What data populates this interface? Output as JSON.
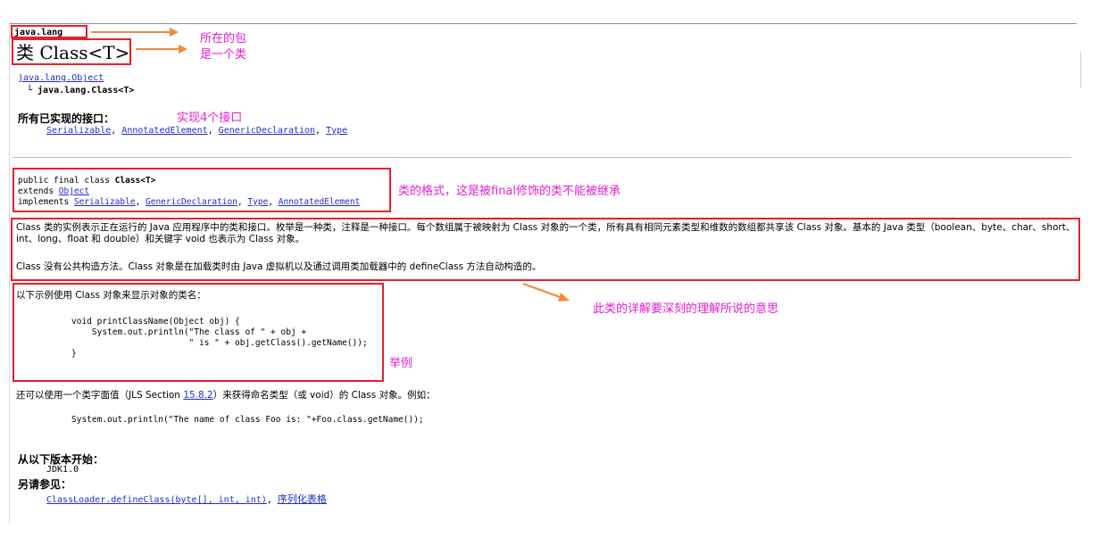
{
  "header": {
    "package": "java.lang",
    "class_title": "类 Class<T>"
  },
  "hierarchy": {
    "parent": "java.lang.Object",
    "child": "└ java.lang.Class<T>"
  },
  "interfaces": {
    "label": "所有已实现的接口：",
    "items": [
      "Serializable",
      "AnnotatedElement",
      "GenericDeclaration",
      "Type"
    ]
  },
  "declaration": {
    "line1_prefix": "public final class ",
    "line1_name": "Class<T>",
    "extends_label": "extends ",
    "extends_link": "Object",
    "implements_label": "implements ",
    "implements_links": [
      "Serializable",
      "GenericDeclaration",
      "Type",
      "AnnotatedElement"
    ]
  },
  "description": {
    "para1": "Class 类的实例表示正在运行的 Java 应用程序中的类和接口。枚举是一种类，注释是一种接口。每个数组属于被映射为 Class 对象的一个类，所有具有相同元素类型和维数的数组都共享该 Class 对象。基本的 Java 类型（boolean、byte、char、short、int、long、float 和 double）和关键字 void 也表示为 Class 对象。",
    "para2": "Class 没有公共构造方法。Class 对象是在加载类时由 Java 虚拟机以及通过调用类加载器中的 defineClass 方法自动构造的。"
  },
  "example": {
    "intro": "以下示例使用 Class 对象来显示对象的类名：",
    "code": "void printClassName(Object obj) {\n    System.out.println(\"The class of \" + obj +\n                       \" is \" + obj.getClass().getName());\n}"
  },
  "literal": {
    "text_before": "还可以使用一个类字面值（JLS Section ",
    "link": "15.8.2",
    "text_after": "）来获得命名类型（或 void）的 Class 对象。例如：",
    "code": "System.out.println(\"The name of class Foo is: \"+Foo.class.getName());"
  },
  "since": {
    "label": "从以下版本开始：",
    "value": "JDK1.0"
  },
  "see_also": {
    "label": "另请参见：",
    "link1": "ClassLoader.defineClass(byte[], int, int)",
    "sep": ", ",
    "link2": "序列化表格"
  },
  "annotations": {
    "package_note": "所在的包",
    "class_note": "是一个类",
    "interfaces_note": "实现4个接口",
    "declaration_note": "类的格式，这是被final修饰的类不能被继承",
    "description_note": "此类的详解要深刻的理解所说的意思",
    "example_note": "举例"
  },
  "colors": {
    "annotation_box": "#e8202a",
    "annotation_text": "#e020d0",
    "arrow": "#f08a3c",
    "link": "#1f2bd4"
  }
}
